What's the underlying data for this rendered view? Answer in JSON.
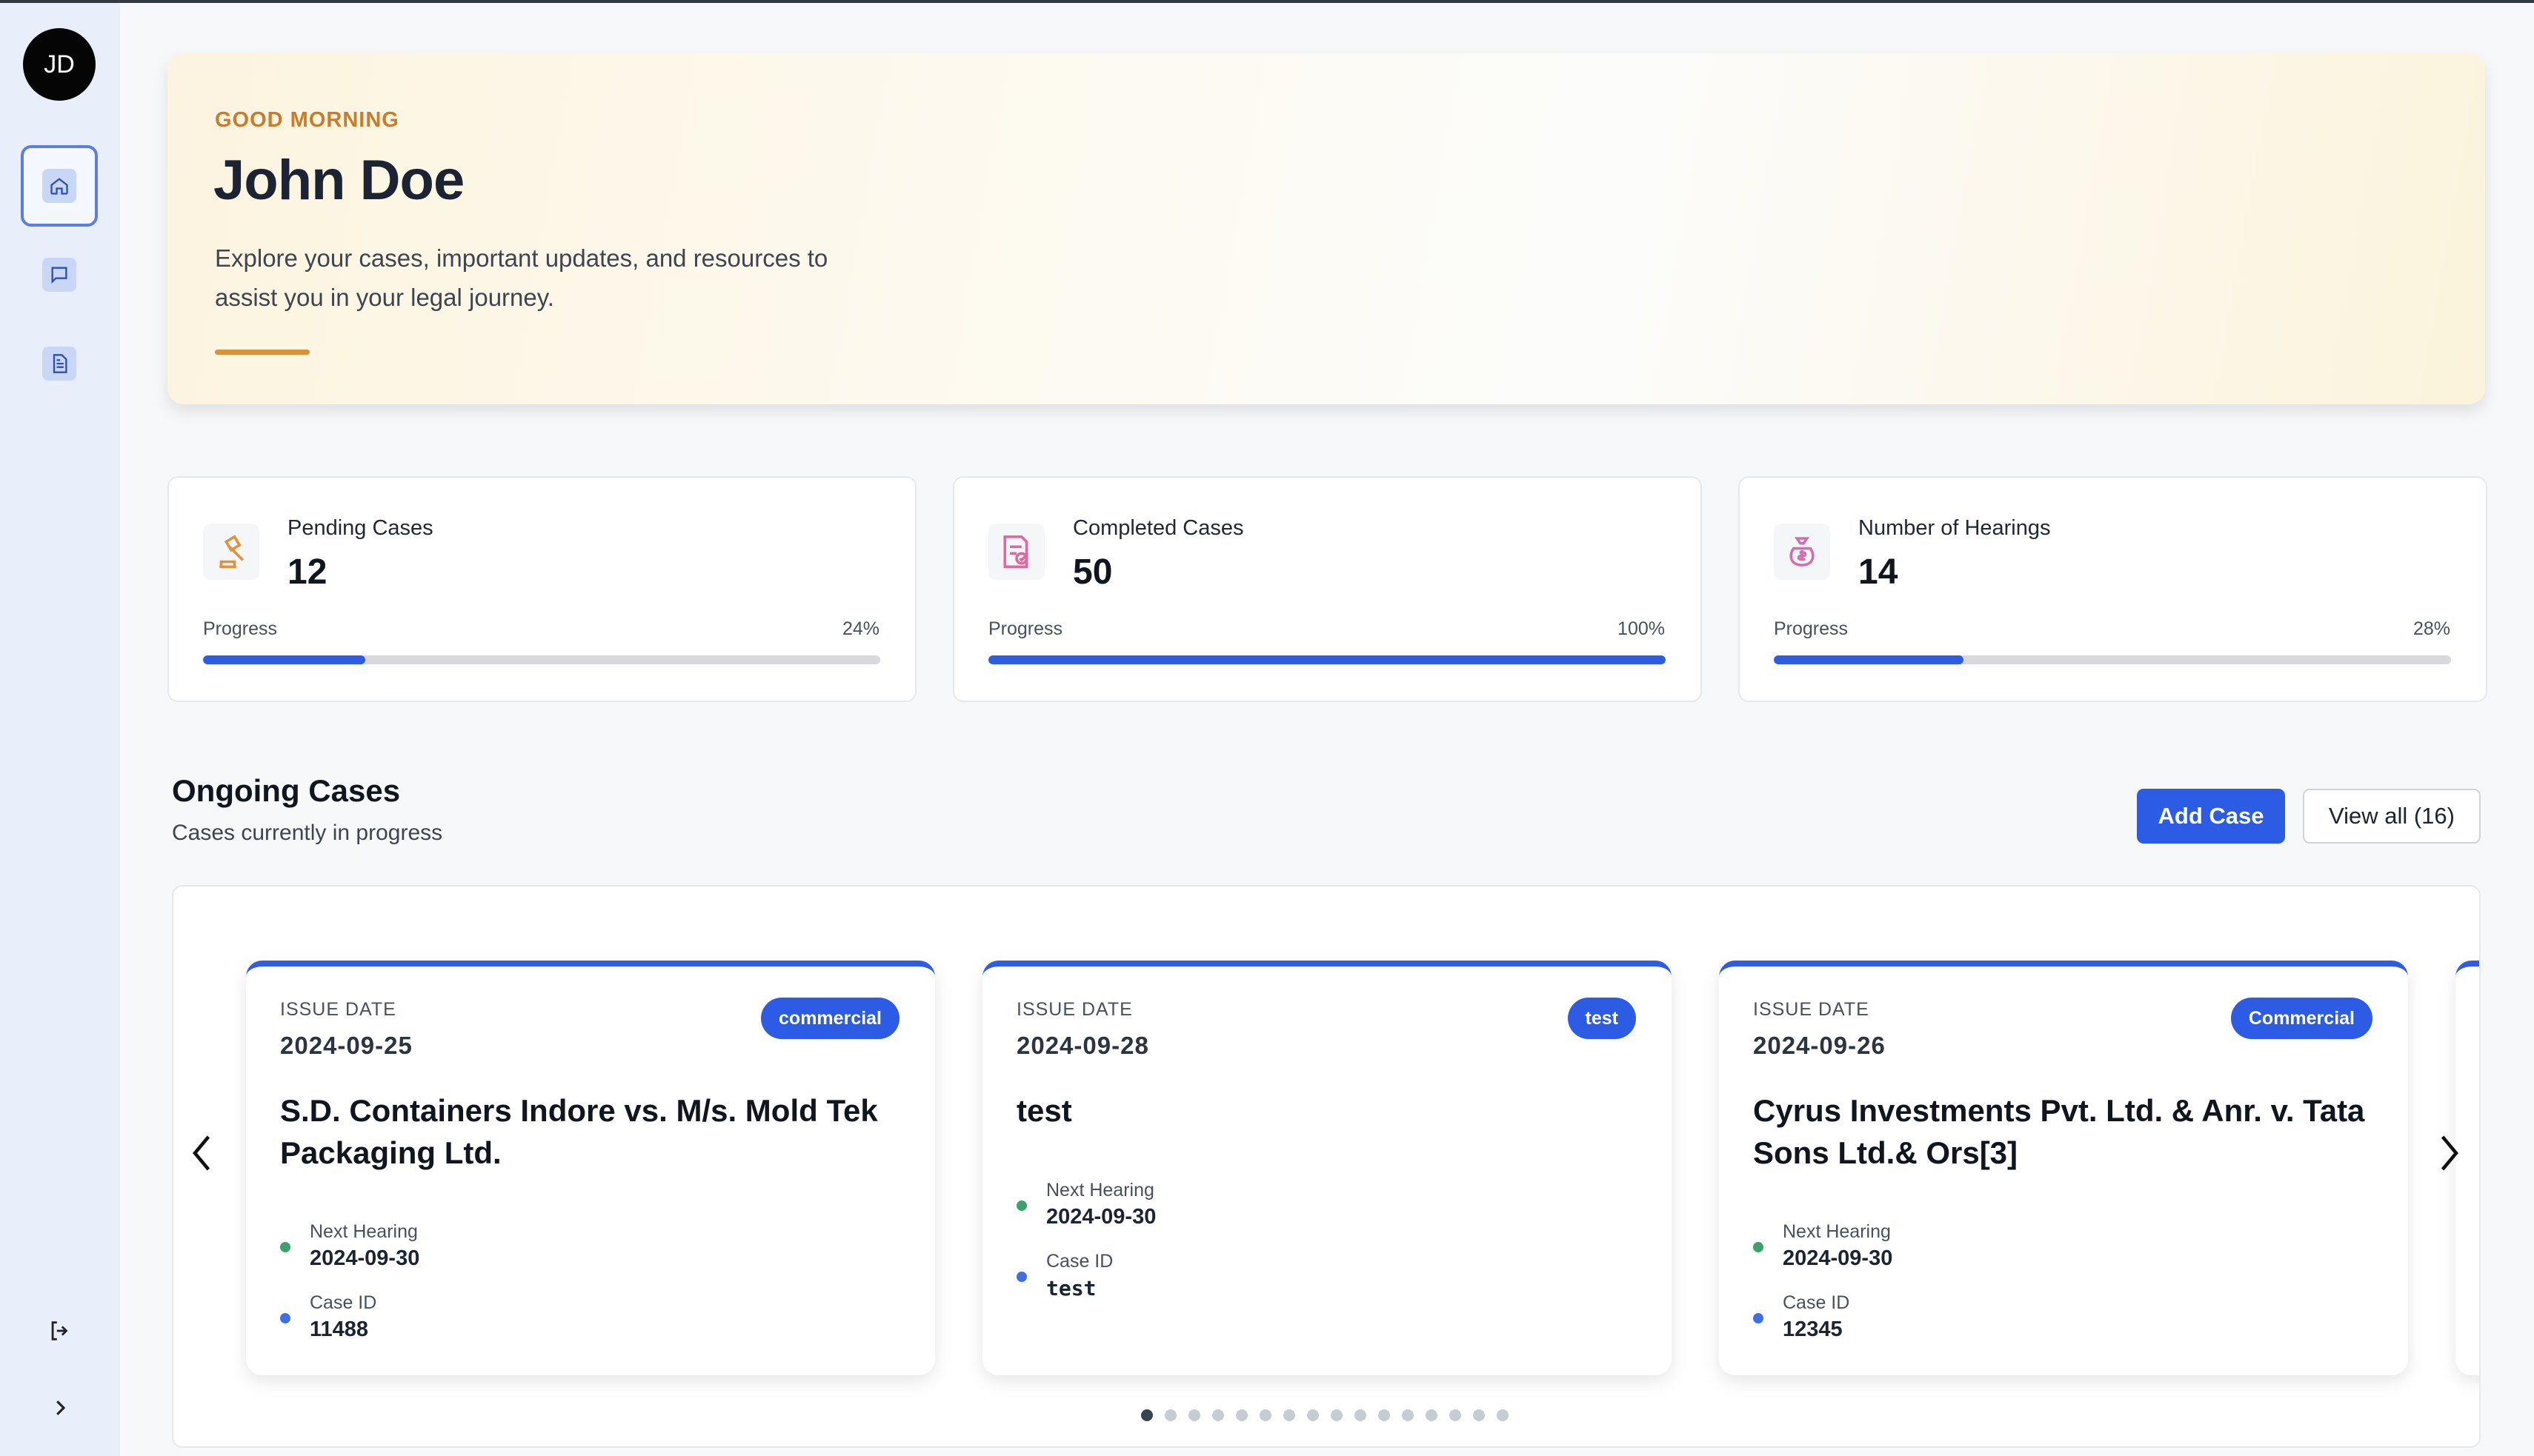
{
  "sidebar": {
    "avatar_initials": "JD",
    "items": [
      {
        "name": "home",
        "icon": "home-icon",
        "active": true
      },
      {
        "name": "chat",
        "icon": "chat-bubble-icon",
        "active": false
      },
      {
        "name": "documents",
        "icon": "document-icon",
        "active": false
      }
    ],
    "logout_icon": "logout-icon",
    "expand_icon": "chevron-right-icon"
  },
  "hero": {
    "greeting": "GOOD MORNING",
    "name": "John Doe",
    "description": "Explore your cases, important updates, and resources to assist you in your legal journey."
  },
  "stats": [
    {
      "label": "Pending Cases",
      "value": "12",
      "progress_label": "Progress",
      "progress_pct": "24%",
      "progress": 0.24,
      "icon": "gavel-icon"
    },
    {
      "label": "Completed Cases",
      "value": "50",
      "progress_label": "Progress",
      "progress_pct": "100%",
      "progress": 1.0,
      "icon": "document-check-icon"
    },
    {
      "label": "Number of Hearings",
      "value": "14",
      "progress_label": "Progress",
      "progress_pct": "28%",
      "progress": 0.28,
      "icon": "money-bag-icon"
    }
  ],
  "ongoing": {
    "title": "Ongoing Cases",
    "subtitle": "Cases currently in progress",
    "add_label": "Add Case",
    "view_all_label": "View all (16)"
  },
  "cases": [
    {
      "issue_label": "ISSUE DATE",
      "issue_date": "2024-09-25",
      "badge": "commercial",
      "title": "S.D. Containers Indore vs. M/s. Mold Tek Packaging Ltd.",
      "hearing_label": "Next Hearing",
      "hearing_date": "2024-09-30",
      "id_label": "Case ID",
      "case_id": "11488"
    },
    {
      "issue_label": "ISSUE DATE",
      "issue_date": "2024-09-28",
      "badge": "test",
      "title": "test",
      "hearing_label": "Next Hearing",
      "hearing_date": "2024-09-30",
      "id_label": "Case ID",
      "case_id": "test"
    },
    {
      "issue_label": "ISSUE DATE",
      "issue_date": "2024-09-26",
      "badge": "Commercial",
      "title": "Cyrus Investments Pvt. Ltd. & Anr. v. Tata Sons Ltd.& Ors[3]",
      "hearing_label": "Next Hearing",
      "hearing_date": "2024-09-30",
      "id_label": "Case ID",
      "case_id": "12345"
    }
  ],
  "carousel": {
    "pages": 16,
    "current_page": 1
  },
  "colors": {
    "accent": "#2b5ce3",
    "greeting": "#c87d2c",
    "hearing_dot": "#3aa26a",
    "case_dot": "#3f6fe6"
  }
}
